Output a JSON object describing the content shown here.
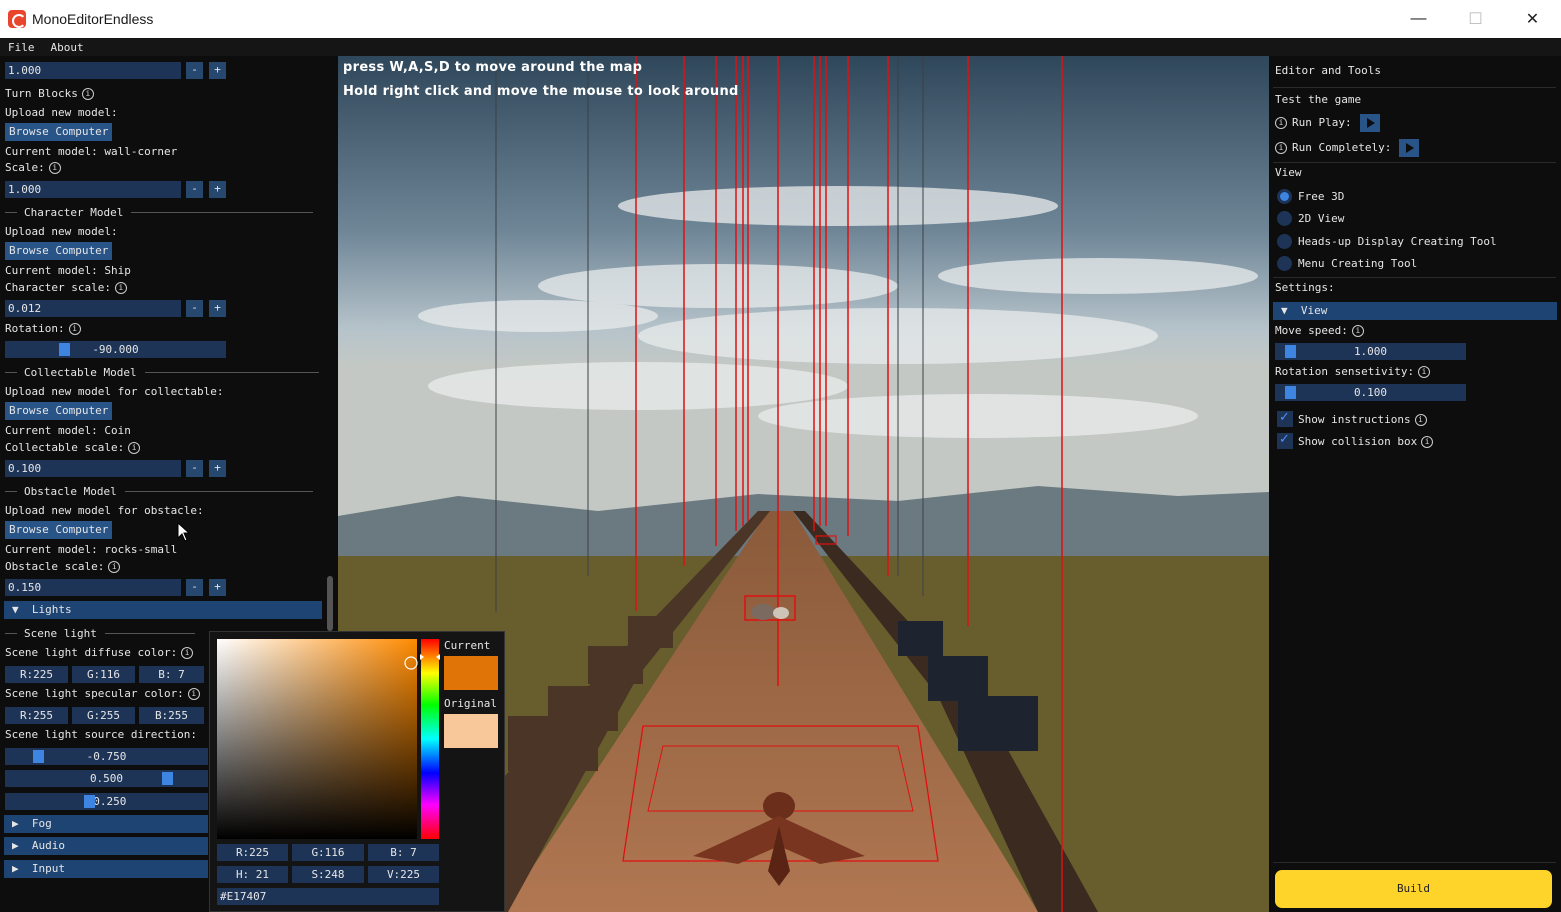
{
  "window": {
    "title": "MonoEditorEndless",
    "minimize": "—",
    "maximize": "☐",
    "close": "✕"
  },
  "menu": [
    "File",
    "About"
  ],
  "left": {
    "top_value": "1.000",
    "turn_blocks_label": "Turn Blocks",
    "upload_label": "Upload new model:",
    "browse": "Browse Computer",
    "turn_current": "Current model: wall-corner",
    "scale_label": "Scale:",
    "turn_scale_value": "1.000",
    "character_section": "Character Model",
    "character_current": "Current model: Ship",
    "character_scale_label": "Character scale:",
    "character_scale_value": "0.012",
    "rotation_label": "Rotation:",
    "rotation_value": "-90.000",
    "collectable_section": "Collectable Model",
    "collectable_upload": "Upload new model for collectable:",
    "collectable_current": "Current model: Coin",
    "collectable_scale_label": "Collectable scale:",
    "collectable_scale_value": "0.100",
    "obstacle_section": "Obstacle Model",
    "obstacle_upload": "Upload new model for obstacle:",
    "obstacle_current": "Current model: rocks-small",
    "obstacle_scale_label": "Obstacle scale:",
    "obstacle_scale_value": "0.150",
    "lights_header": "Lights",
    "scene_light_section": "Scene light",
    "diffuse_label": "Scene light diffuse color:",
    "diffuse": {
      "r": "R:225",
      "g": "G:116",
      "b": "B:  7"
    },
    "specular_label": "Scene light specular color:",
    "specular": {
      "r": "R:255",
      "g": "G:255",
      "b": "B:255"
    },
    "direction_label": "Scene light source direction:",
    "direction": [
      "-0.750",
      "0.500",
      "-0.250"
    ],
    "fog_header": "Fog",
    "audio_header": "Audio",
    "input_header": "Input",
    "minus": "-",
    "plus": "+"
  },
  "viewport": {
    "instruction1": "press W,A,S,D to move around the map",
    "instruction2": "Hold right click and move the mouse to look around"
  },
  "picker": {
    "current_label": "Current",
    "original_label": "Original",
    "current_color": "#E17407",
    "original_color": "#F8C89A",
    "r": "R:225",
    "g": "G:116",
    "b": "B:  7",
    "h": "H: 21",
    "s": "S:248",
    "v": "V:225",
    "hex": "#E17407"
  },
  "right": {
    "title": "Editor and Tools",
    "test_label": "Test the game",
    "run_play": "Run Play:",
    "run_completely": "Run Completely:",
    "view_label": "View",
    "view_options": [
      "Free 3D",
      "2D View",
      "Heads-up Display Creating Tool",
      "Menu Creating Tool"
    ],
    "settings_label": "Settings:",
    "view_header": "View",
    "move_speed_label": "Move speed:",
    "move_speed_value": "1.000",
    "rotation_label": "Rotation sensetivity:",
    "rotation_value": "0.100",
    "show_instructions": "Show instructions",
    "show_collision": "Show collision box",
    "build": "Build"
  },
  "colors": {
    "accent": "#3d85e0",
    "frame": "#1d3457",
    "header": "#1e4474",
    "build": "#ffd42a"
  },
  "icons": [
    "app-logo-icon",
    "info-icon",
    "play-icon",
    "triangle-down-icon",
    "triangle-right-icon",
    "checkmark-icon",
    "mouse-cursor-icon"
  ]
}
